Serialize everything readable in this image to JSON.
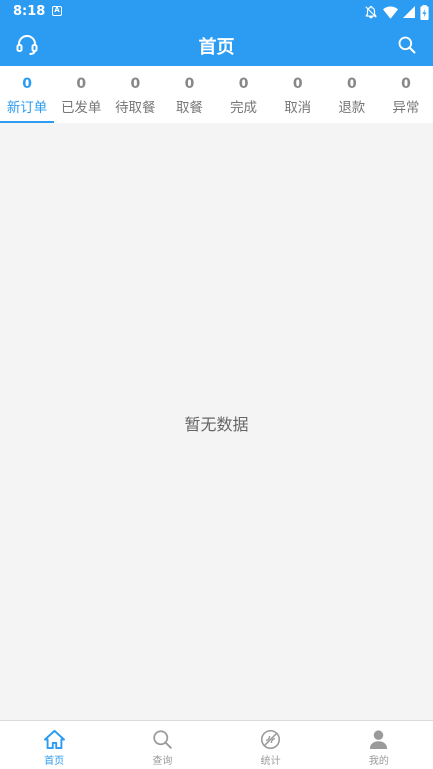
{
  "status": {
    "time": "8:18",
    "notification_icon": "A"
  },
  "header": {
    "title": "首页",
    "left_icon": "headset-icon",
    "right_icon": "search-icon"
  },
  "tabs": [
    {
      "count": "0",
      "label": "新订单",
      "active": true
    },
    {
      "count": "0",
      "label": "已发单"
    },
    {
      "count": "0",
      "label": "待取餐"
    },
    {
      "count": "0",
      "label": "取餐"
    },
    {
      "count": "0",
      "label": "完成"
    },
    {
      "count": "0",
      "label": "取消"
    },
    {
      "count": "0",
      "label": "退款"
    },
    {
      "count": "0",
      "label": "异常"
    }
  ],
  "content": {
    "empty_text": "暂无数据"
  },
  "bottom_nav": [
    {
      "label": "首页",
      "icon": "home-icon",
      "active": true
    },
    {
      "label": "查询",
      "icon": "search-icon"
    },
    {
      "label": "统计",
      "icon": "stats-icon"
    },
    {
      "label": "我的",
      "icon": "user-icon"
    }
  ],
  "colors": {
    "primary": "#2b9cf2",
    "background": "#f4f4f4",
    "inactive": "#999999"
  }
}
